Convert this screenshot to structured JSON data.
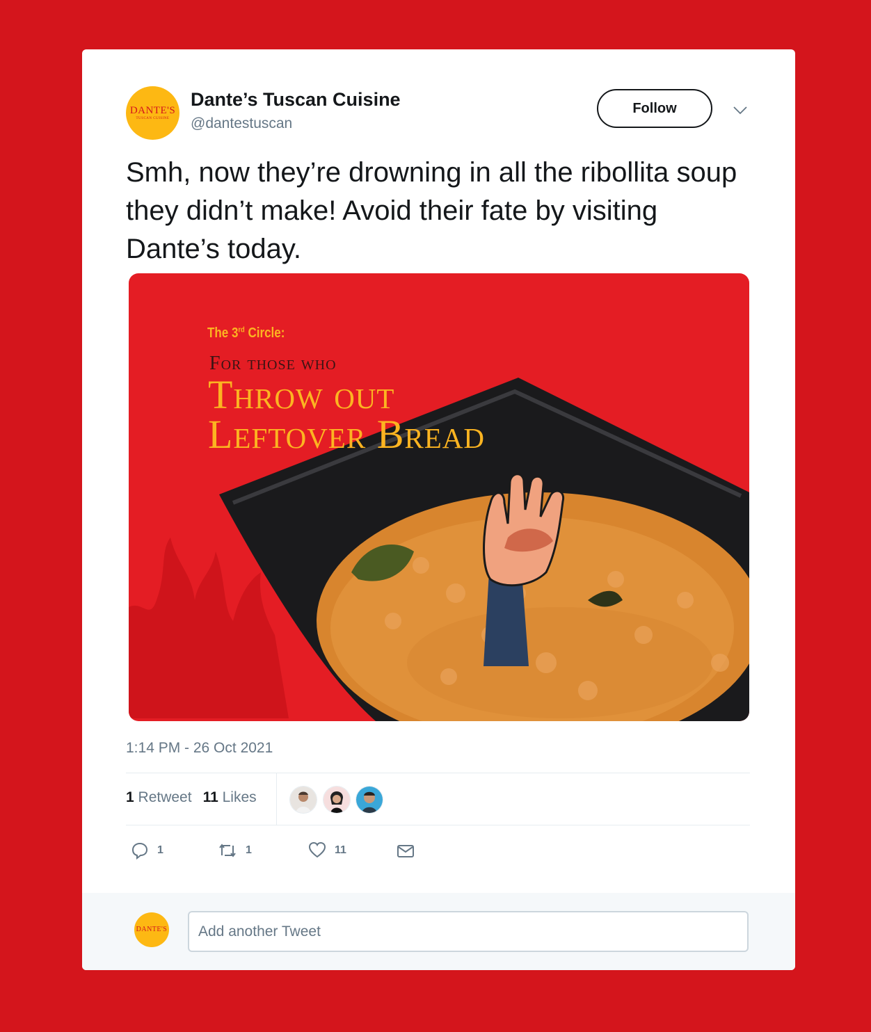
{
  "colors": {
    "background": "#d4151c",
    "brand_yellow": "#fdb813",
    "text_primary": "#14171a",
    "text_secondary": "#657786",
    "image_red": "#e41d24"
  },
  "account": {
    "avatar_logo": "DANTE'S",
    "avatar_logo_sub": "TUSCAN CUISINE",
    "name": "Dante’s Tuscan Cuisine",
    "handle": "@dantestuscan"
  },
  "header": {
    "follow_label": "Follow",
    "menu_icon": "chevron-down-icon"
  },
  "tweet": {
    "text": "Smh, now they’re drowning in all the ribollita soup they didn’t make! Avoid their fate by visiting Dante’s today.",
    "timestamp": "1:14 PM - 26 Oct 2021"
  },
  "image": {
    "circle_prefix": "The 3",
    "circle_sup": "rd",
    "circle_suffix": " Circle:",
    "subtitle": "For those who",
    "title_line1": "Throw out",
    "title_line2": "Leftover Bread"
  },
  "stats": {
    "retweet_count": "1",
    "retweet_label": "Retweet",
    "likes_count": "11",
    "likes_label": "Likes"
  },
  "actions": {
    "reply_icon": "reply-icon",
    "reply_count": "1",
    "retweet_icon": "retweet-icon",
    "retweet_count": "1",
    "like_icon": "heart-icon",
    "like_count": "11",
    "dm_icon": "envelope-icon"
  },
  "reply_box": {
    "placeholder": "Add another Tweet"
  }
}
